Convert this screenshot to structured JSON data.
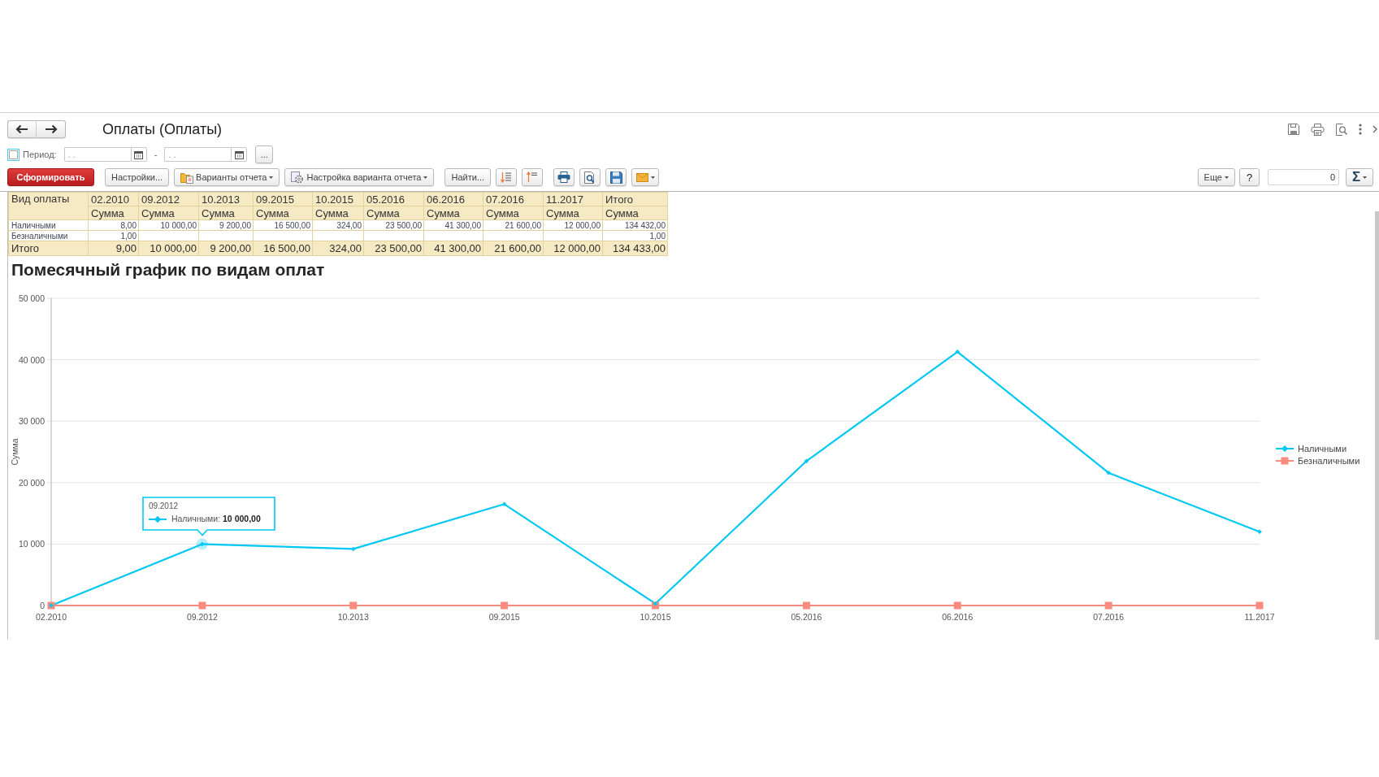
{
  "window": {
    "title": "Оплаты (Оплаты)"
  },
  "period": {
    "checked": false,
    "label": "Период:",
    "start_field": {
      "placeholder": ". ."
    },
    "separator": "-",
    "end_field": {
      "placeholder": ". ."
    },
    "select_button": "..."
  },
  "toolbar": {
    "generate_button": "Сформировать",
    "settings_button": "Настройки...",
    "variants_button": "Варианты отчета",
    "variant_settings_button": "Настройка варианта отчета",
    "find_button": "Найти...",
    "more_button": "Еще",
    "help_button": "?",
    "sum_field": {
      "value": "0"
    },
    "sum_button": "Σ"
  },
  "table": {
    "corner": "Вид оплаты",
    "columns": [
      {
        "period": "02.2010",
        "measure": "Сумма"
      },
      {
        "period": "09.2012",
        "measure": "Сумма"
      },
      {
        "period": "10.2013",
        "measure": "Сумма"
      },
      {
        "period": "09.2015",
        "measure": "Сумма"
      },
      {
        "period": "10.2015",
        "measure": "Сумма"
      },
      {
        "period": "05.2016",
        "measure": "Сумма"
      },
      {
        "period": "06.2016",
        "measure": "Сумма"
      },
      {
        "period": "07.2016",
        "measure": "Сумма"
      },
      {
        "period": "11.2017",
        "measure": "Сумма"
      },
      {
        "period": "Итого",
        "measure": "Сумма"
      }
    ],
    "rows": [
      {
        "name": "Наличными",
        "cells": [
          "8,00",
          "10 000,00",
          "9 200,00",
          "16 500,00",
          "324,00",
          "23 500,00",
          "41 300,00",
          "21 600,00",
          "12 000,00",
          "134 432,00"
        ]
      },
      {
        "name": "Безналичными",
        "cells": [
          "1,00",
          null,
          null,
          null,
          null,
          null,
          null,
          null,
          null,
          "1,00"
        ]
      }
    ],
    "total": {
      "label": "Итого",
      "cells": [
        "9,00",
        "10 000,00",
        "9 200,00",
        "16 500,00",
        "324,00",
        "23 500,00",
        "41 300,00",
        "21 600,00",
        "12 000,00",
        "134 433,00"
      ]
    }
  },
  "chart": {
    "title": "Помесячный график по видам оплат",
    "tooltip": {
      "title": "09.2012"
    },
    "chart_data": {
      "type": "line",
      "ylabel": "Сумма",
      "categories": [
        "02.2010",
        "09.2012",
        "10.2013",
        "09.2015",
        "10.2015",
        "05.2016",
        "06.2016",
        "07.2016",
        "11.2017"
      ],
      "series": [
        {
          "name": "Наличными",
          "color": "#00c8f2",
          "marker": "diamond",
          "values": [
            0,
            10000,
            9200,
            16500,
            300,
            23500,
            41300,
            21600,
            12000
          ]
        },
        {
          "name": "Безналичными",
          "color": "#f88a7e",
          "marker": "square",
          "values": [
            0,
            0,
            0,
            0,
            0,
            0,
            0,
            0,
            0
          ]
        }
      ],
      "ylim": [
        0,
        50000
      ],
      "yticks": [
        {
          "value": 0,
          "label": "0"
        },
        {
          "value": 10000,
          "label": "10 000"
        },
        {
          "value": 20000,
          "label": "20 000"
        },
        {
          "value": 30000,
          "label": "30 000"
        },
        {
          "value": 40000,
          "label": "40 000"
        },
        {
          "value": 50000,
          "label": "50 000"
        }
      ],
      "grid": true,
      "legend": "right",
      "annotations": [
        {
          "x": "09.2012",
          "y": 10000,
          "text": "Наличными: **10 000,00**"
        }
      ]
    }
  }
}
